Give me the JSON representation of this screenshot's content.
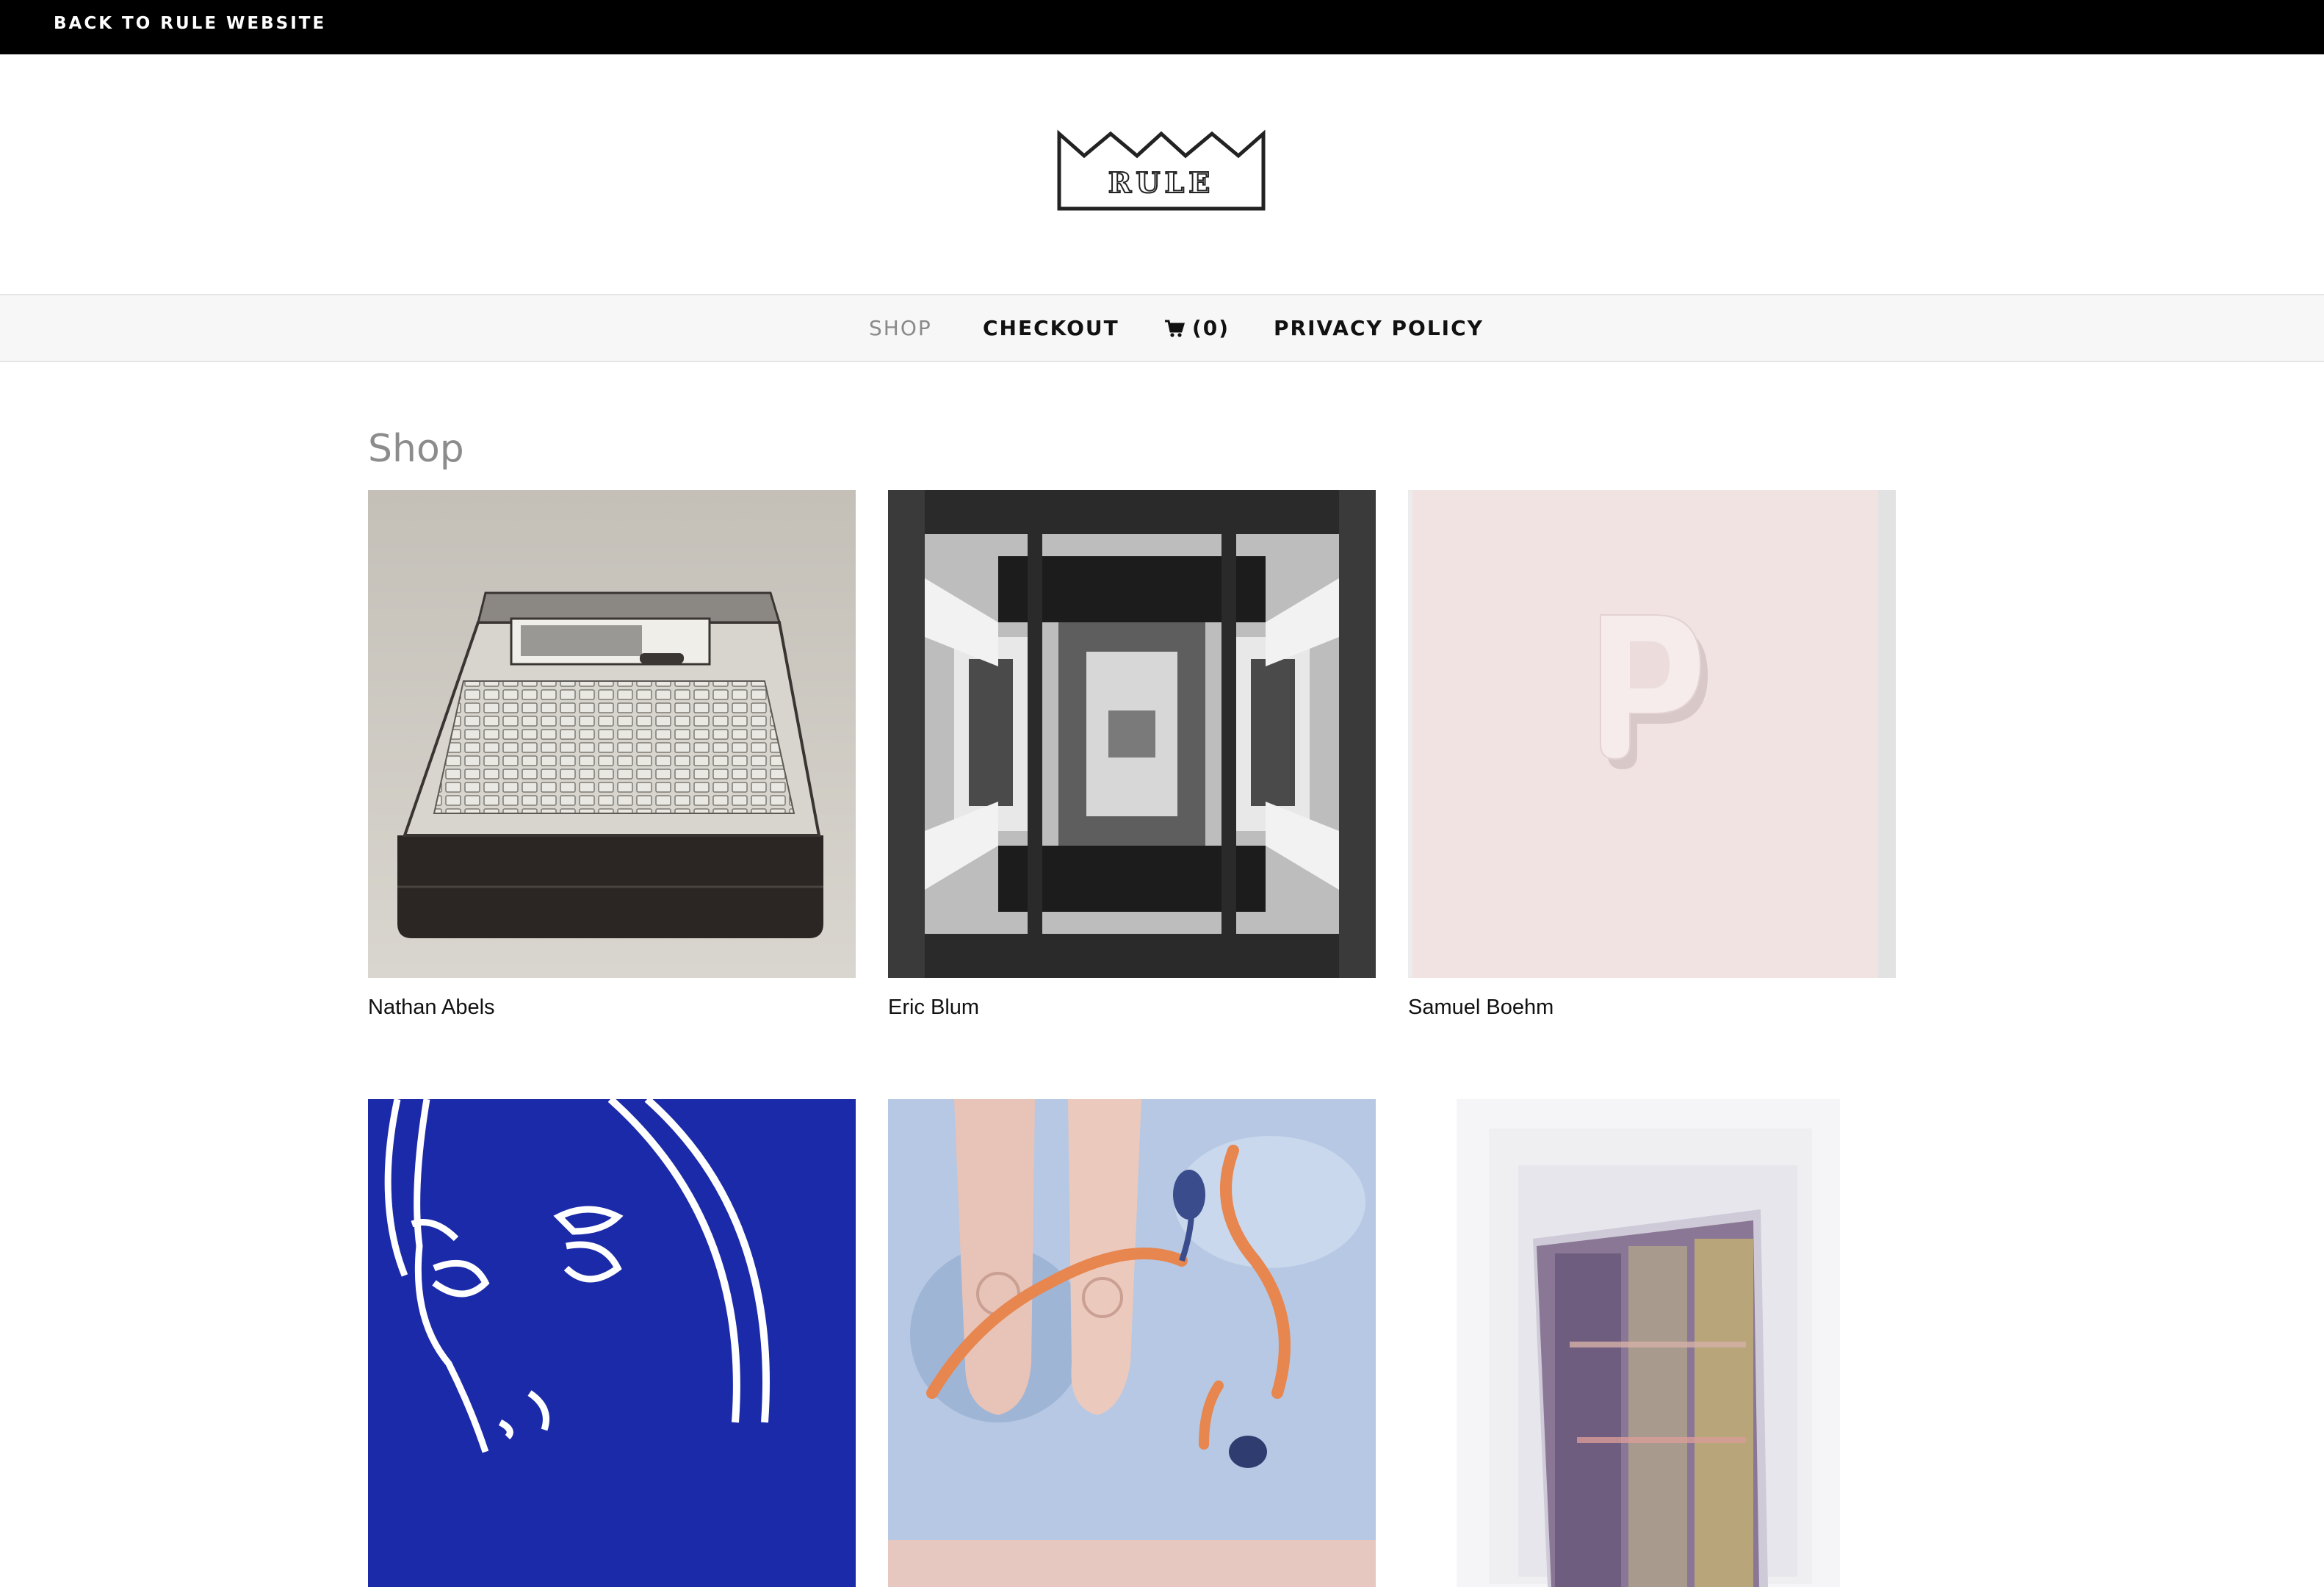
{
  "topbar": {
    "back_link": "BACK TO RULE WEBSITE"
  },
  "logo": {
    "text": "RULE"
  },
  "nav": {
    "items": [
      {
        "label": "SHOP",
        "active": true
      },
      {
        "label": "CHECKOUT",
        "active": false
      },
      {
        "label": "(0)",
        "icon": "cart-icon"
      },
      {
        "label": "PRIVACY POLICY",
        "active": false
      }
    ]
  },
  "page": {
    "title": "Shop"
  },
  "products": [
    {
      "artist": "Nathan Abels"
    },
    {
      "artist": "Eric Blum"
    },
    {
      "artist": "Samuel Boehm"
    },
    {
      "artist": ""
    },
    {
      "artist": ""
    },
    {
      "artist": ""
    }
  ],
  "colors": {
    "topbar": "#000000",
    "nav_background": "#f7f7f7",
    "active_nav": "#8a8a8a",
    "title": "#8c8c8c"
  }
}
